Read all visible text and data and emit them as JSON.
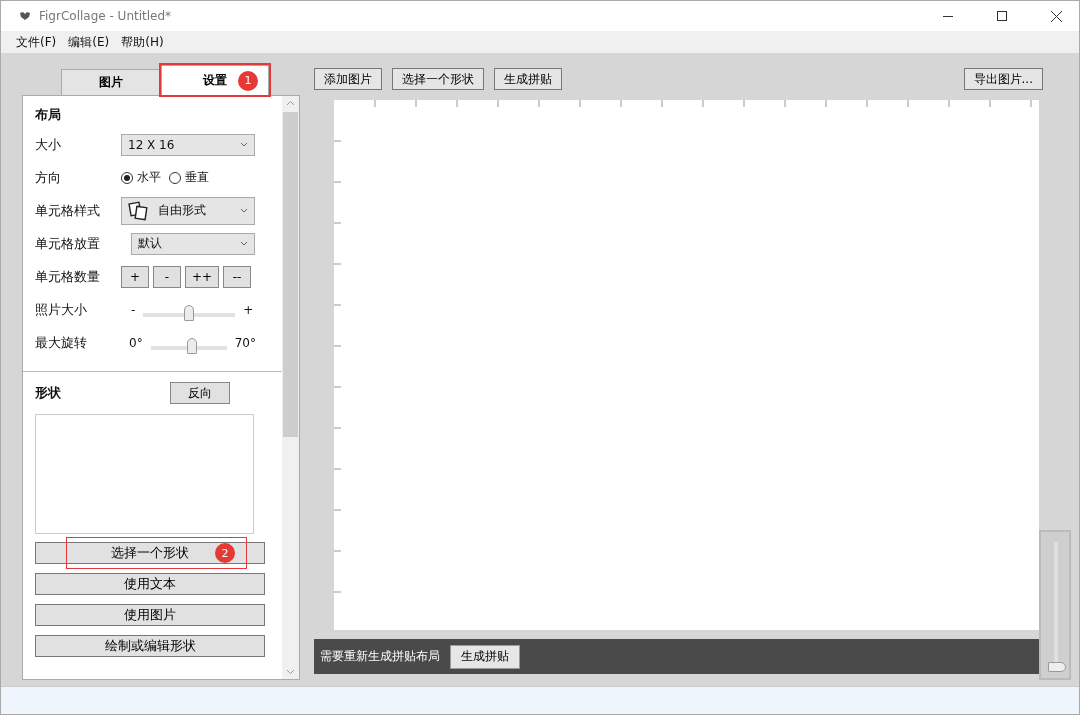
{
  "window": {
    "title": "FigrCollage - Untitled*"
  },
  "menu": [
    "文件(F)",
    "编辑(E)",
    "帮助(H)"
  ],
  "tabs": [
    {
      "label": "图片",
      "selected": false
    },
    {
      "label": "设置",
      "selected": true,
      "callout": "1"
    }
  ],
  "layout": {
    "heading": "布局",
    "rows": [
      {
        "kind": "select",
        "label": "大小",
        "value": "12 X 16"
      },
      {
        "kind": "radio",
        "label": "方向",
        "options": [
          {
            "label": "水平",
            "selected": true
          },
          {
            "label": "垂直",
            "selected": false
          }
        ]
      },
      {
        "kind": "select-icon",
        "label": "单元格样式",
        "value": "自由形式"
      },
      {
        "kind": "select",
        "label": "单元格放置",
        "value": "默认"
      },
      {
        "kind": "buttons",
        "label": "单元格数量",
        "buttons": [
          "+",
          "-",
          "++",
          "--"
        ]
      },
      {
        "kind": "slider",
        "label": "照片大小",
        "min": "-",
        "max": "+",
        "level": 0.5
      },
      {
        "kind": "slider",
        "label": "最大旋转",
        "min": "0°",
        "max": "70°",
        "level": 0.55
      }
    ]
  },
  "shapes": {
    "heading": "形状",
    "reverse_button": "反向",
    "buttons": [
      {
        "label": "选择一个形状",
        "callout": "2"
      },
      {
        "label": "使用文本"
      },
      {
        "label": "使用图片"
      },
      {
        "label": "绘制或编辑形状"
      }
    ]
  },
  "toolbar": {
    "left": [
      "添加图片",
      "选择一个形状",
      "生成拼贴"
    ],
    "right": "导出图片..."
  },
  "notice": {
    "text": "需要重新生成拼贴布局",
    "button": "生成拼贴"
  },
  "zoom": {
    "level": 0
  }
}
